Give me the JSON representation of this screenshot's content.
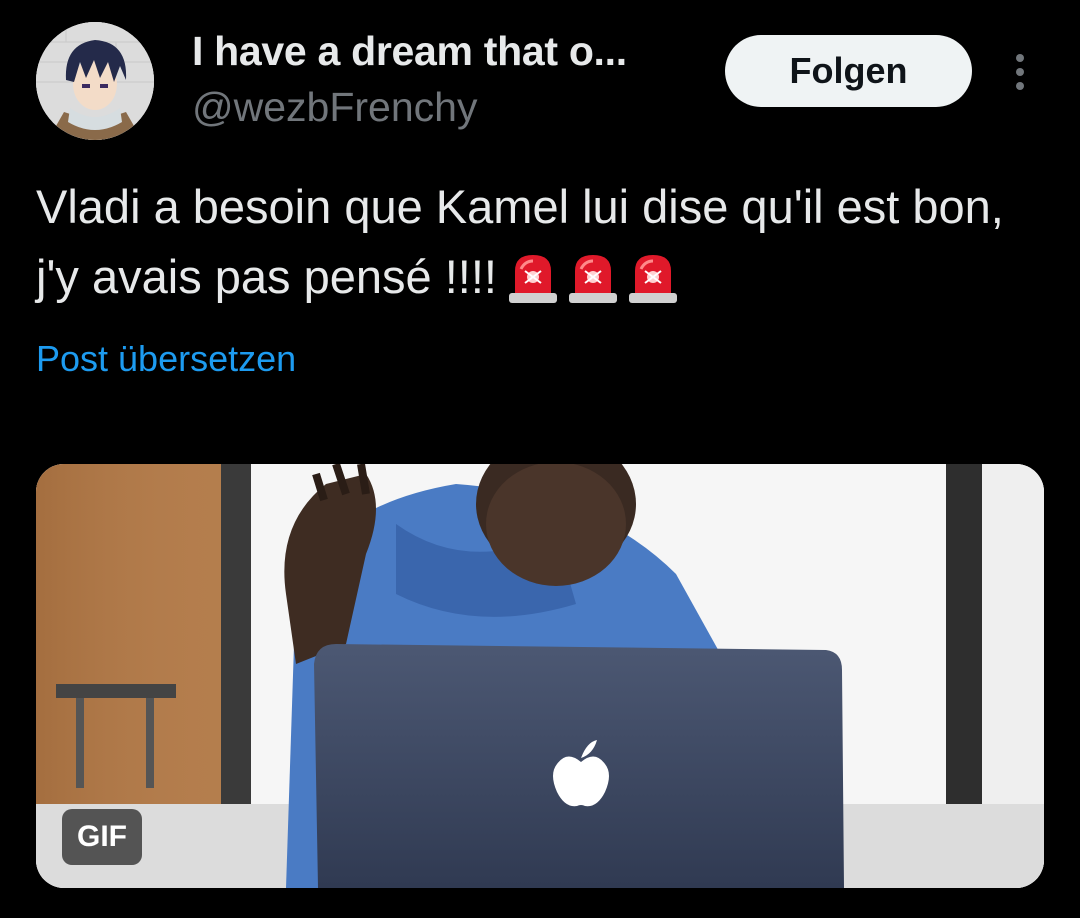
{
  "author": {
    "display_name": "I have a dream that o...",
    "handle": "@wezbFrenchy",
    "avatar_icon": "anime-avatar"
  },
  "follow_button": {
    "label": "Folgen"
  },
  "more_menu": {
    "icon": "vertical-ellipsis-icon"
  },
  "tweet": {
    "text": "Vladi a besoin que Kamel lui dise qu'il est bon, j'y avais pas pensé !!!!",
    "emojis": [
      "rotating-light-emoji",
      "rotating-light-emoji",
      "rotating-light-emoji"
    ],
    "translate_label": "Post übersetzen"
  },
  "media": {
    "type_badge": "GIF"
  },
  "colors": {
    "background": "#000000",
    "primary_text": "#e7e9ea",
    "secondary_text": "#71767b",
    "link": "#1d9bf0",
    "follow_bg": "#eff3f4",
    "follow_text": "#0f1419"
  }
}
